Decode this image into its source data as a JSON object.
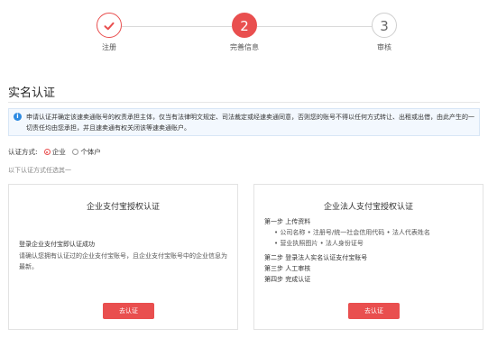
{
  "stepper": {
    "steps": [
      {
        "label": "注册",
        "state": "done"
      },
      {
        "number": "2",
        "label": "完善信息",
        "state": "active"
      },
      {
        "number": "3",
        "label": "审核",
        "state": "todo"
      }
    ]
  },
  "page_title": "实名认证",
  "notice": {
    "text": "申请认证并确定该速卖通账号的权责承担主体，仅当有法律明文规定、司法裁定或经速卖通同意，否则您的账号不得以任何方式转让、出租或出借，由此产生的一切责任均由您承担，并且速卖通有权关闭该等速卖通账户。"
  },
  "auth_method": {
    "label": "认证方式:",
    "options": [
      {
        "label": "企业",
        "selected": true
      },
      {
        "label": "个体户",
        "selected": false
      }
    ]
  },
  "hint": "以下认证方式任选其一",
  "cards": [
    {
      "title": "企业支付宝授权认证",
      "subtitle": "登录企业支付宝即认证成功",
      "desc": "请确认您拥有认证过的企业支付宝账号，且企业支付宝账号中的企业信息为最新。",
      "button": "去认证"
    },
    {
      "title": "企业法人支付宝授权认证",
      "steps": [
        "第一步 上传资料",
        "• 公司名称 • 注册号/统一社会信用代码 • 法人代表姓名",
        "• 营业执照图片 • 法人身份证号",
        "第二步 登录法人实名认证支付宝账号",
        "第三步 人工审核",
        "第四步 完成认证"
      ],
      "button": "去认证"
    }
  ],
  "colors": {
    "accent": "#e94f4f",
    "info": "#2d8ae1"
  }
}
